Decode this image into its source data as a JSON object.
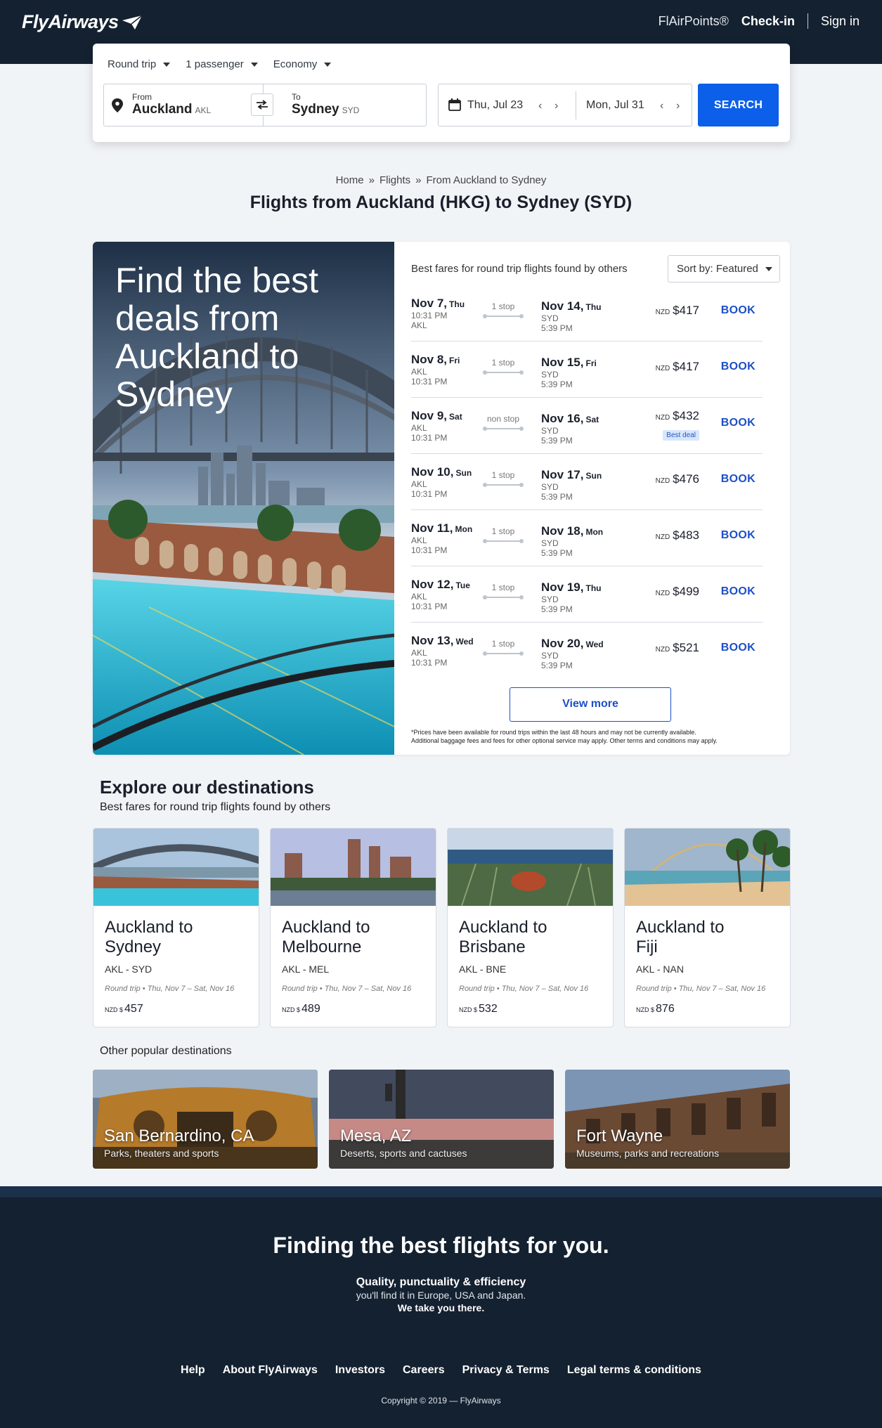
{
  "header": {
    "logo": "FlyAirways",
    "nav": {
      "points": "FlAirPoints®",
      "checkin": "Check-in",
      "signin": "Sign in"
    }
  },
  "search": {
    "trip_type": "Round trip",
    "passengers": "1 passenger",
    "cabin": "Economy",
    "from_label": "From",
    "from_city": "Auckland",
    "from_code": "AKL",
    "to_label": "To",
    "to_city": "Sydney",
    "to_code": "SYD",
    "depart_date": "Thu, Jul 23",
    "return_date": "Mon, Jul 31",
    "button": "SEARCH"
  },
  "breadcrumb": [
    "Home",
    "Flights",
    "From Auckland to Sydney"
  ],
  "page_title": "Flights from Auckland (HKG) to Sydney (SYD)",
  "hero": {
    "text": "Find the best deals from Auckland to Sydney"
  },
  "fares": {
    "heading": "Best fares for round trip flights found by others",
    "sort": "Sort by: Featured",
    "book_label": "BOOK",
    "currency": "NZD",
    "rows": [
      {
        "dep_date": "Nov 7,",
        "dep_dow": "Thu",
        "dep_l1": "10:31 PM",
        "dep_l2": "AKL",
        "stops": "1 stop",
        "ret_date": "Nov 14,",
        "ret_dow": "Thu",
        "ret_code": "SYD",
        "ret_time": "5:39 PM",
        "price": "$417",
        "badge": ""
      },
      {
        "dep_date": "Nov 8,",
        "dep_dow": "Fri",
        "dep_l1": "AKL",
        "dep_l2": "10:31 PM",
        "stops": "1 stop",
        "ret_date": "Nov 15,",
        "ret_dow": "Fri",
        "ret_code": "SYD",
        "ret_time": "5:39 PM",
        "price": "$417",
        "badge": ""
      },
      {
        "dep_date": "Nov 9,",
        "dep_dow": "Sat",
        "dep_l1": "AKL",
        "dep_l2": "10:31 PM",
        "stops": "non stop",
        "ret_date": "Nov 16,",
        "ret_dow": "Sat",
        "ret_code": "SYD",
        "ret_time": "5:39 PM",
        "price": "$432",
        "badge": "Best deal"
      },
      {
        "dep_date": "Nov 10,",
        "dep_dow": "Sun",
        "dep_l1": "AKL",
        "dep_l2": "10:31 PM",
        "stops": "1 stop",
        "ret_date": "Nov 17,",
        "ret_dow": "Sun",
        "ret_code": "SYD",
        "ret_time": "5:39 PM",
        "price": "$476",
        "badge": ""
      },
      {
        "dep_date": "Nov 11,",
        "dep_dow": "Mon",
        "dep_l1": "AKL",
        "dep_l2": "10:31 PM",
        "stops": "1 stop",
        "ret_date": "Nov 18,",
        "ret_dow": "Mon",
        "ret_code": "SYD",
        "ret_time": "5:39 PM",
        "price": "$483",
        "badge": ""
      },
      {
        "dep_date": "Nov 12,",
        "dep_dow": "Tue",
        "dep_l1": "AKL",
        "dep_l2": "10:31 PM",
        "stops": "1 stop",
        "ret_date": "Nov 19,",
        "ret_dow": "Thu",
        "ret_code": "SYD",
        "ret_time": "5:39 PM",
        "price": "$499",
        "badge": ""
      },
      {
        "dep_date": "Nov 13,",
        "dep_dow": "Wed",
        "dep_l1": "AKL",
        "dep_l2": "10:31 PM",
        "stops": "1 stop",
        "ret_date": "Nov 20,",
        "ret_dow": "Wed",
        "ret_code": "SYD",
        "ret_time": "5:39 PM",
        "price": "$521",
        "badge": ""
      }
    ],
    "view_more": "View more",
    "fine_print_1": "*Prices have been available for round trips within the last 48 hours and may not be currently available.",
    "fine_print_2": "Additional baggage fees and fees for other optional service may apply. Other terms and conditions may apply."
  },
  "explore": {
    "title": "Explore our destinations",
    "subtitle": "Best fares for round trip flights found by others",
    "cards": [
      {
        "line1": "Auckland to",
        "line2": "Sydney",
        "codes": "AKL - SYD",
        "trip": "Round trip • Thu, Nov 7 – Sat, Nov 16",
        "currency": "NZD $",
        "price": "457"
      },
      {
        "line1": "Auckland to",
        "line2": "Melbourne",
        "codes": "AKL - MEL",
        "trip": "Round trip • Thu, Nov 7 – Sat, Nov 16",
        "currency": "NZD $",
        "price": "489"
      },
      {
        "line1": "Auckland to",
        "line2": "Brisbane",
        "codes": "AKL - BNE",
        "trip": "Round trip • Thu, Nov 7 – Sat, Nov 16",
        "currency": "NZD $",
        "price": "532"
      },
      {
        "line1": "Auckland to",
        "line2": "Fiji",
        "codes": "AKL - NAN",
        "trip": "Round trip • Thu, Nov 7 – Sat, Nov 16",
        "currency": "NZD $",
        "price": "876"
      }
    ]
  },
  "popular": {
    "title": "Other popular destinations",
    "cards": [
      {
        "name": "San Bernardino, CA",
        "desc": "Parks, theaters and sports"
      },
      {
        "name": "Mesa, AZ",
        "desc": "Deserts, sports and cactuses"
      },
      {
        "name": "Fort Wayne",
        "desc": "Museums, parks and recreations"
      }
    ]
  },
  "footer": {
    "headline": "Finding the best flights for you.",
    "tag1": "Quality, punctuality & efficiency",
    "tag2": "you'll find it in Europe, USA and Japan.",
    "tag3": "We take you there.",
    "links": [
      "Help",
      "About FlyAirways",
      "Investors",
      "Careers",
      "Privacy & Terms",
      "Legal terms & conditions"
    ],
    "copyright": "Copyright © 2019 — FlyAirways"
  },
  "colors": {
    "header_bg": "#142130",
    "accent": "#0c5fe8",
    "link": "#1d4fc7",
    "badge_bg": "#d8e6fb"
  }
}
